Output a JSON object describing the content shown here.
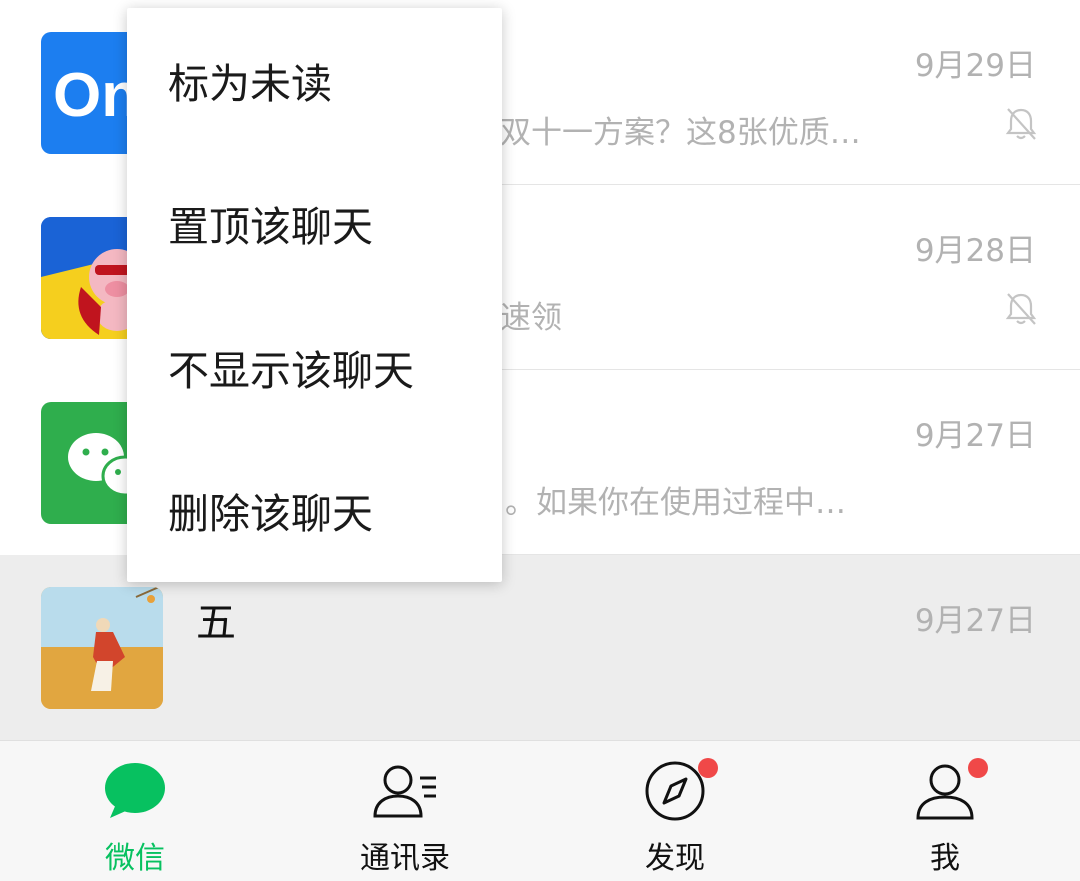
{
  "chats": [
    {
      "name": "",
      "time": "9月29日",
      "preview": "双十一方案？这8张优质…",
      "muted": true
    },
    {
      "name": "",
      "time": "9月28日",
      "preview": "速领",
      "muted": true
    },
    {
      "name": "",
      "time": "9月27日",
      "preview": "。如果你在使用过程中…",
      "muted": false
    },
    {
      "name": "五",
      "time": "9月27日",
      "preview": "",
      "muted": false
    }
  ],
  "context_menu": {
    "items": [
      "标为未读",
      "置顶该聊天",
      "不显示该聊天",
      "删除该聊天"
    ]
  },
  "tabbar": {
    "tabs": [
      {
        "label": "微信",
        "icon": "chat-bubble-icon",
        "active": true,
        "badge": false
      },
      {
        "label": "通讯录",
        "icon": "contacts-icon",
        "active": false,
        "badge": false
      },
      {
        "label": "发现",
        "icon": "compass-icon",
        "active": false,
        "badge": true
      },
      {
        "label": "我",
        "icon": "person-icon",
        "active": false,
        "badge": true
      }
    ]
  },
  "colors": {
    "accent": "#07c160",
    "badge": "#f04848",
    "selected_row": "#ededed",
    "muted_text": "#b2b2b2"
  }
}
